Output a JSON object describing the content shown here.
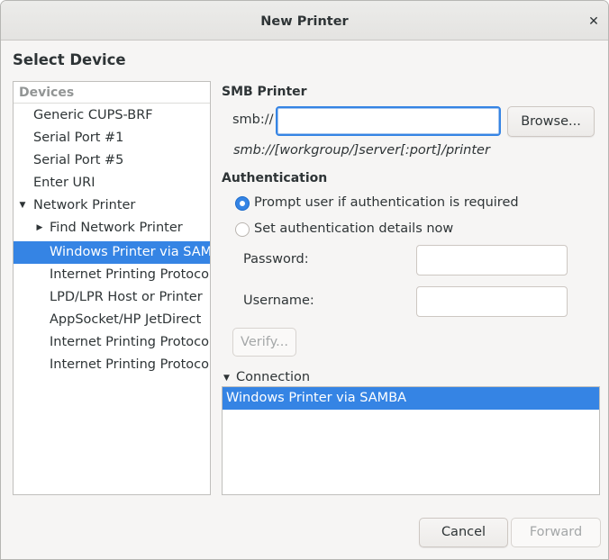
{
  "window": {
    "title": "New Printer",
    "close_glyph": "✕"
  },
  "heading": "Select Device",
  "devices": {
    "header": "Devices",
    "items": [
      {
        "label": "Generic CUPS-BRF",
        "level": 0
      },
      {
        "label": "Serial Port #1",
        "level": 0
      },
      {
        "label": "Serial Port #5",
        "level": 0
      },
      {
        "label": "Enter URI",
        "level": 0
      },
      {
        "label": "Network Printer",
        "level": 0,
        "expander": "▼"
      },
      {
        "label": "Find Network Printer",
        "level": 1,
        "expander": "▶"
      },
      {
        "label": "Windows Printer via SAMBA",
        "level": 1,
        "selected": true
      },
      {
        "label": "Internet Printing Protocol (ipps)",
        "level": 1
      },
      {
        "label": "LPD/LPR Host or Printer",
        "level": 1
      },
      {
        "label": "AppSocket/HP JetDirect",
        "level": 1
      },
      {
        "label": "Internet Printing Protocol (ipp)",
        "level": 1
      },
      {
        "label": "Internet Printing Protocol (https)",
        "level": 1
      }
    ]
  },
  "smb": {
    "title": "SMB Printer",
    "prefix_label": "smb://",
    "uri_value": "",
    "browse_label": "Browse...",
    "format_hint": "smb://[workgroup/]server[:port]/printer"
  },
  "auth": {
    "title": "Authentication",
    "prompt_option": "Prompt user if authentication is required",
    "set_option": "Set authentication details now",
    "password_label": "Password:",
    "password_value": "",
    "username_label": "Username:",
    "username_value": "",
    "verify_label": "Verify..."
  },
  "connection": {
    "title": "Connection",
    "expander": "▼",
    "items": [
      "Windows Printer via SAMBA"
    ]
  },
  "footer": {
    "cancel_label": "Cancel",
    "forward_label": "Forward"
  },
  "colors": {
    "accent": "#3584e4",
    "window_bg": "#f6f5f4"
  }
}
